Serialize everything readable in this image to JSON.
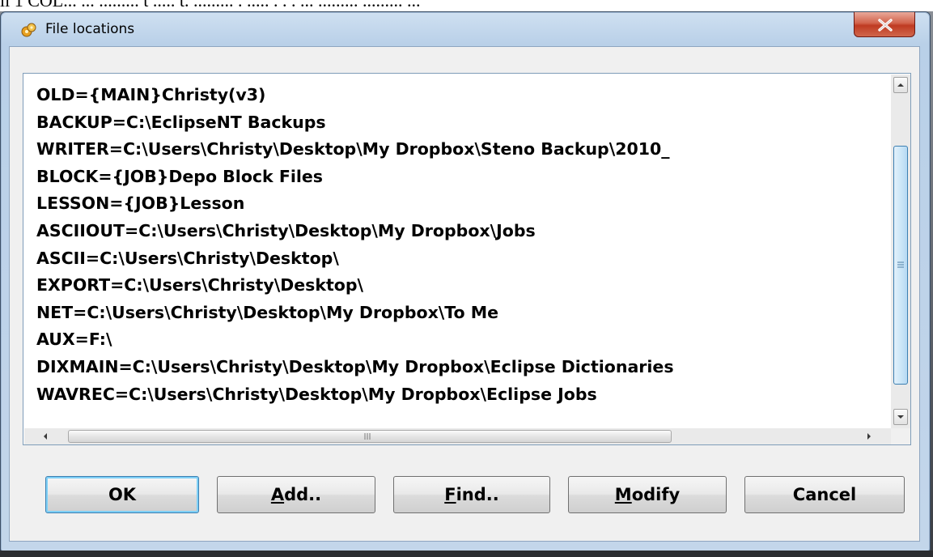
{
  "background": {
    "partial_text": "ll 1 COL... ... ......... t ..... t. ......... . ..... . . . ... ......... ......... ..."
  },
  "window": {
    "title": "File locations",
    "close_label": "x"
  },
  "locations": [
    "OLD={MAIN}Christy(v3)",
    "BACKUP=C:\\EclipseNT Backups",
    "WRITER=C:\\Users\\Christy\\Desktop\\My Dropbox\\Steno Backup\\2010_",
    "BLOCK={JOB}Depo Block Files",
    "LESSON={JOB}Lesson",
    "ASCIIOUT=C:\\Users\\Christy\\Desktop\\My Dropbox\\Jobs",
    "ASCII=C:\\Users\\Christy\\Desktop\\",
    "EXPORT=C:\\Users\\Christy\\Desktop\\",
    "NET=C:\\Users\\Christy\\Desktop\\My Dropbox\\To Me",
    "AUX=F:\\",
    "DIXMAIN=C:\\Users\\Christy\\Desktop\\My Dropbox\\Eclipse Dictionaries",
    "WAVREC=C:\\Users\\Christy\\Desktop\\My Dropbox\\Eclipse Jobs"
  ],
  "buttons": {
    "ok": "OK",
    "add_mnemonic": "A",
    "add_rest": "dd..",
    "find_mnemonic": "F",
    "find_rest": "ind..",
    "modify_mnemonic": "M",
    "modify_rest": "odify",
    "cancel": "Cancel"
  },
  "colors": {
    "titlebar": "#b9d0e8",
    "close_button": "#c7432a",
    "scroll_thumb": "#cde7f8",
    "default_button_glow": "#7fd0f6"
  },
  "icons": [
    "app-icon",
    "close-icon",
    "scroll-up-arrow-icon",
    "scroll-down-arrow-icon",
    "scroll-left-arrow-icon",
    "scroll-right-arrow-icon",
    "grip-icon"
  ]
}
